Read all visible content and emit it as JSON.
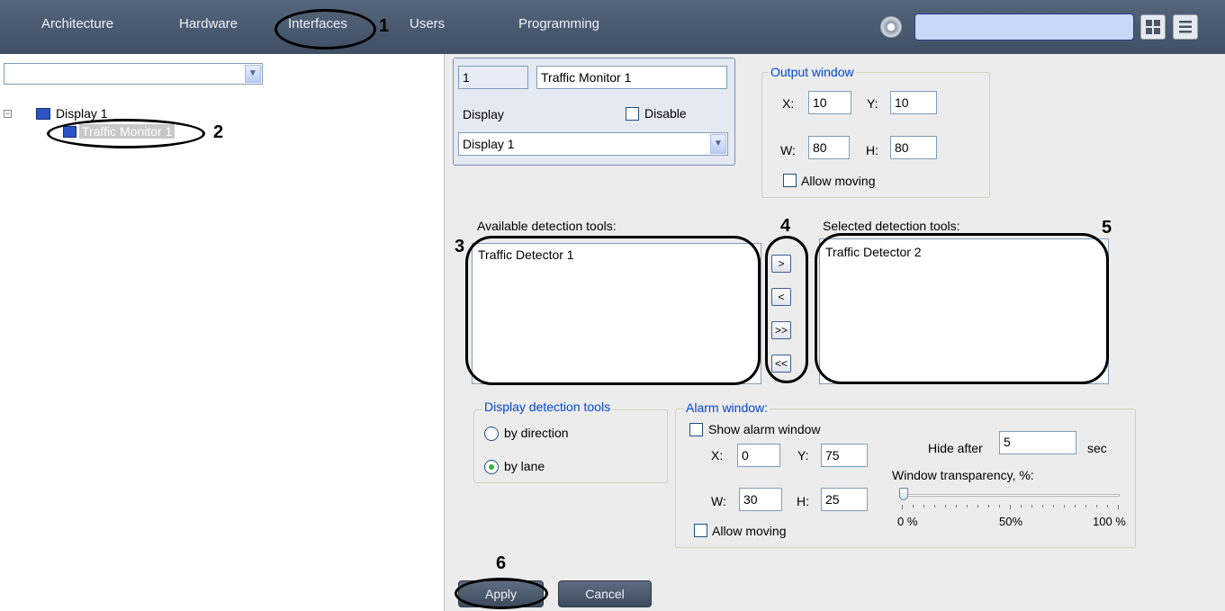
{
  "nav": {
    "tabs": [
      "Architecture",
      "Hardware",
      "Interfaces",
      "Users",
      "Programming"
    ]
  },
  "left": {
    "tree": {
      "parent_label": "Display 1",
      "child_label": "Traffic Monitor 1"
    }
  },
  "form": {
    "id_value": "1",
    "name_value": "Traffic Monitor 1",
    "display_label": "Display",
    "disable_label": "Disable",
    "display_select": "Display 1"
  },
  "output_window": {
    "title": "Output window",
    "x_label": "X:",
    "x": "10",
    "y_label": "Y:",
    "y": "10",
    "w_label": "W:",
    "w": "80",
    "h_label": "H:",
    "h": "80",
    "allow_moving": "Allow moving"
  },
  "detection": {
    "available_label": "Available detection tools:",
    "available_items": [
      "Traffic Detector 1"
    ],
    "selected_label": "Selected detection tools:",
    "selected_items": [
      "Traffic Detector 2"
    ],
    "btn_add": ">",
    "btn_remove": "<",
    "btn_add_all": ">>",
    "btn_remove_all": "<<"
  },
  "display_tools": {
    "title": "Display detection tools",
    "by_direction": "by direction",
    "by_lane": "by lane",
    "selected": "by lane"
  },
  "alarm_window": {
    "title": "Alarm window:",
    "show_label": "Show alarm window",
    "x_label": "X:",
    "x": "0",
    "y_label": "Y:",
    "y": "75",
    "w_label": "W:",
    "w": "30",
    "h_label": "H:",
    "h": "25",
    "allow_moving": "Allow moving",
    "hide_after_label": "Hide after",
    "hide_after_value": "5",
    "hide_after_unit": "sec",
    "transparency_label": "Window transparency, %:",
    "transparency_value": 0,
    "scale": [
      "0 %",
      "50%",
      "100 %"
    ]
  },
  "buttons": {
    "apply": "Apply",
    "cancel": "Cancel"
  },
  "callouts": [
    "1",
    "2",
    "3",
    "4",
    "5",
    "6"
  ]
}
